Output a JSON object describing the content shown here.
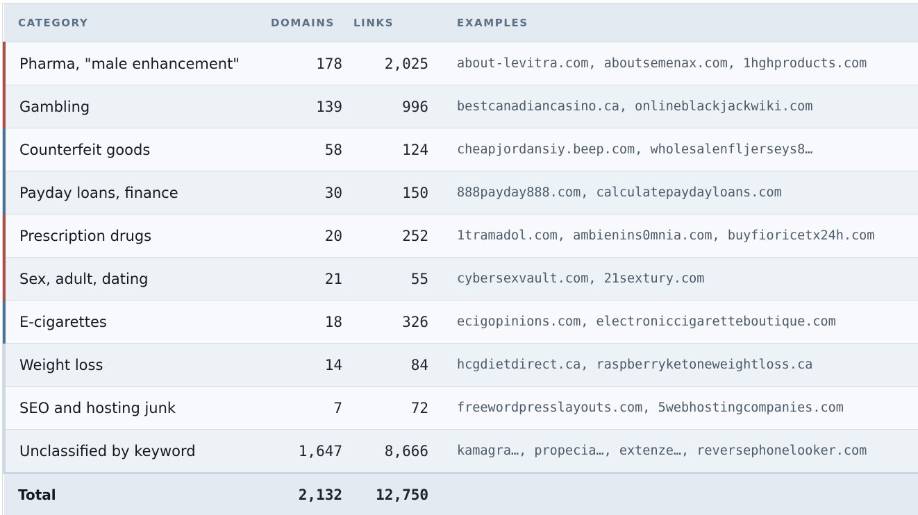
{
  "table": {
    "headers": {
      "category": "CATEGORY",
      "domains": "DOMAINS",
      "links": "LINKS",
      "examples": "EXAMPLES"
    },
    "rows": [
      {
        "category": "Pharma, \"male enhancement\"",
        "domains": "178",
        "links": "2,025",
        "examples": "about-levitra.com, aboutsemenax.com, 1hghproducts.com",
        "accent": "red"
      },
      {
        "category": "Gambling",
        "domains": "139",
        "links": "996",
        "examples": "bestcanadiancasino.ca, onlineblackjackwiki.com",
        "accent": "red"
      },
      {
        "category": "Counterfeit goods",
        "domains": "58",
        "links": "124",
        "examples": "cheapjordansiy.beep.com, wholesalenfljerseys8…",
        "accent": "blue"
      },
      {
        "category": "Payday loans, finance",
        "domains": "30",
        "links": "150",
        "examples": "888payday888.com, calculatepaydayloans.com",
        "accent": "blue"
      },
      {
        "category": "Prescription drugs",
        "domains": "20",
        "links": "252",
        "examples": "1tramadol.com, ambienins0mnia.com, buyfioricetx24h.com",
        "accent": "red"
      },
      {
        "category": "Sex, adult, dating",
        "domains": "21",
        "links": "55",
        "examples": "cybersexvault.com, 21sextury.com",
        "accent": "red"
      },
      {
        "category": "E-cigarettes",
        "domains": "18",
        "links": "326",
        "examples": "ecigopinions.com, electroniccigaretteboutique.com",
        "accent": "blue"
      },
      {
        "category": "Weight loss",
        "domains": "14",
        "links": "84",
        "examples": "hcgdietdirect.ca, raspberryketoneweightloss.ca",
        "accent": "grey"
      },
      {
        "category": "SEO and hosting junk",
        "domains": "7",
        "links": "72",
        "examples": "freewordpresslayouts.com, 5webhostingcompanies.com",
        "accent": "grey"
      },
      {
        "category": "Unclassified by keyword",
        "domains": "1,647",
        "links": "8,666",
        "examples": "kamagra…, propecia…, extenze…, reversephonelooker.com",
        "accent": "grey"
      }
    ],
    "total": {
      "label": "Total",
      "domains": "2,132",
      "links": "12,750"
    }
  },
  "colors": {
    "accent_red": "#b04c42",
    "accent_blue": "#47739b",
    "accent_grey": "#cfd9e2",
    "header_bg": "#e3eaf1"
  }
}
